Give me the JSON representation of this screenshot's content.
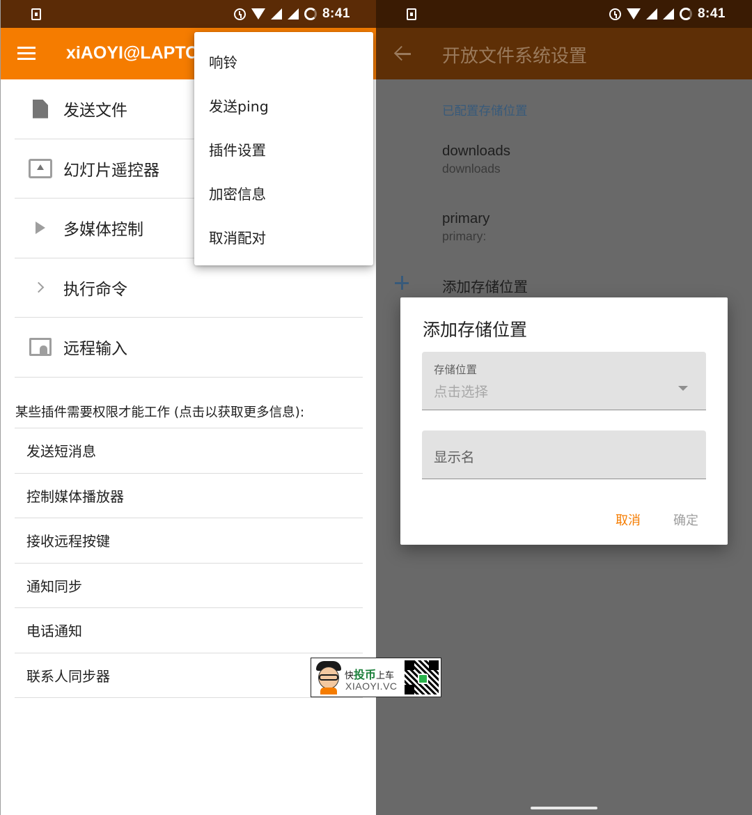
{
  "status_bar": {
    "time": "8:41"
  },
  "left": {
    "device_title": "xiAOYI@LAPTO",
    "plugins": [
      {
        "label": "发送文件",
        "icon": "file-icon"
      },
      {
        "label": "幻灯片遥控器",
        "icon": "presentation-icon"
      },
      {
        "label": "多媒体控制",
        "icon": "play-icon"
      },
      {
        "label": "执行命令",
        "icon": "chevron-right-icon"
      },
      {
        "label": "远程输入",
        "icon": "touchpad-icon"
      }
    ],
    "permission_note": "某些插件需要权限才能工作 (点击以获取更多信息):",
    "permission_plugins": [
      "发送短消息",
      "控制媒体播放器",
      "接收远程按键",
      "通知同步",
      "电话通知",
      "联系人同步器"
    ],
    "overflow_menu": [
      "响铃",
      "发送ping",
      "插件设置",
      "加密信息",
      "取消配对"
    ]
  },
  "right": {
    "title": "开放文件系统设置",
    "section_header": "已配置存储位置",
    "storage_locations": [
      {
        "name": "downloads",
        "path": "downloads"
      },
      {
        "name": "primary",
        "path": "primary:"
      }
    ],
    "add_label": "添加存储位置",
    "dialog": {
      "title": "添加存储位置",
      "storage_field": {
        "caption": "存储位置",
        "value": "点击选择"
      },
      "display_name_placeholder": "显示名",
      "cancel": "取消",
      "ok": "确定"
    }
  },
  "watermark": {
    "brand_prefix": "快",
    "brand_main": "投币",
    "brand_suffix": "上车",
    "site": "XIAOYI.VC"
  },
  "colors": {
    "accent": "#f57c00",
    "statusbar_left": "#5b2b06",
    "dim_overlay": "#696969"
  }
}
